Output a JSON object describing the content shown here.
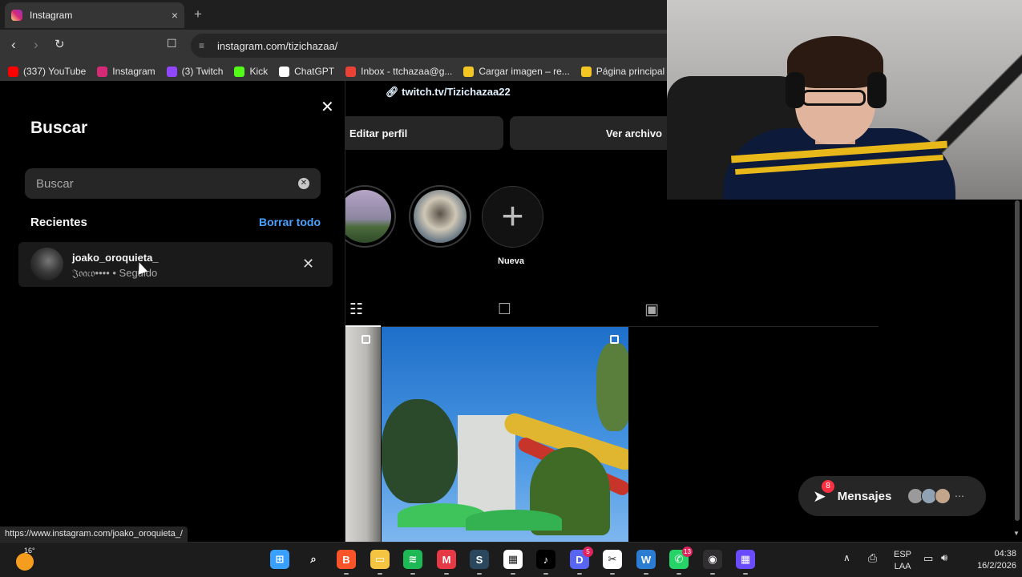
{
  "browser": {
    "tab_title": "Instagram",
    "tab_close": "×",
    "new_tab": "+",
    "url": "instagram.com/tizichazaa/",
    "bookmarks": [
      {
        "label": "(337) YouTube",
        "color": "#ff0000"
      },
      {
        "label": "Instagram",
        "color": "#d62976"
      },
      {
        "label": "(3) Twitch",
        "color": "#9146ff"
      },
      {
        "label": "Kick",
        "color": "#53fc18"
      },
      {
        "label": "ChatGPT",
        "color": "#ffffff"
      },
      {
        "label": "Inbox - ttchazaa@g...",
        "color": "#ea4335"
      },
      {
        "label": "Cargar imagen – re...",
        "color": "#f3c623"
      },
      {
        "label": "Página principal",
        "color": "#f3c623"
      }
    ]
  },
  "search_panel": {
    "title": "Buscar",
    "placeholder": "Buscar",
    "recent_title": "Recientes",
    "clear_all": "Borrar todo",
    "recent_items": [
      {
        "username": "joako_oroquieta_",
        "meta": "𝔍𝔬𝔞𝔠𝔬•••• • Seguido"
      }
    ]
  },
  "profile": {
    "link": "twitch.tv/Tizichazaa22",
    "edit_button": "Editar perfil",
    "archive_button": "Ver archivo",
    "new_highlight_label": "Nueva"
  },
  "messages": {
    "label": "Mensajes",
    "badge": "8",
    "avatar_colors": [
      "#9a9a9a",
      "#8fa3b5",
      "#c2a58a"
    ]
  },
  "status_url": "https://www.instagram.com/joako_oroquieta_/",
  "taskbar": {
    "temperature": "16°",
    "apps": [
      {
        "name": "windows-start-icon",
        "color": "#3aa0ff",
        "glyph": "⊞"
      },
      {
        "name": "search-icon",
        "color": "transparent",
        "glyph": "⌕"
      },
      {
        "name": "brave-icon",
        "color": "#fb542b",
        "glyph": "B"
      },
      {
        "name": "file-explorer-icon",
        "color": "#f5c542",
        "glyph": "▭"
      },
      {
        "name": "spotify-icon",
        "color": "#1db954",
        "glyph": "≋"
      },
      {
        "name": "medal-icon",
        "color": "#e63946",
        "glyph": "M"
      },
      {
        "name": "steam-icon",
        "color": "#2a475e",
        "glyph": "S"
      },
      {
        "name": "ms-store-icon",
        "color": "#ffffff",
        "glyph": "▦"
      },
      {
        "name": "tiktok-icon",
        "color": "#000000",
        "glyph": "♪"
      },
      {
        "name": "discord-icon",
        "color": "#5865f2",
        "glyph": "D",
        "badge": "5"
      },
      {
        "name": "capcut-icon",
        "color": "#ffffff",
        "glyph": "✂"
      },
      {
        "name": "word-icon",
        "color": "#2b7cd3",
        "glyph": "W"
      },
      {
        "name": "whatsapp-icon",
        "color": "#25d366",
        "glyph": "✆",
        "badge": "13"
      },
      {
        "name": "obs-icon",
        "color": "#302e31",
        "glyph": "◉"
      },
      {
        "name": "app-grid-icon",
        "color": "#6b4bff",
        "glyph": "▦"
      }
    ],
    "language": "ESP",
    "layout": "LAA",
    "time": "04:38",
    "date": "16/2/2026"
  }
}
